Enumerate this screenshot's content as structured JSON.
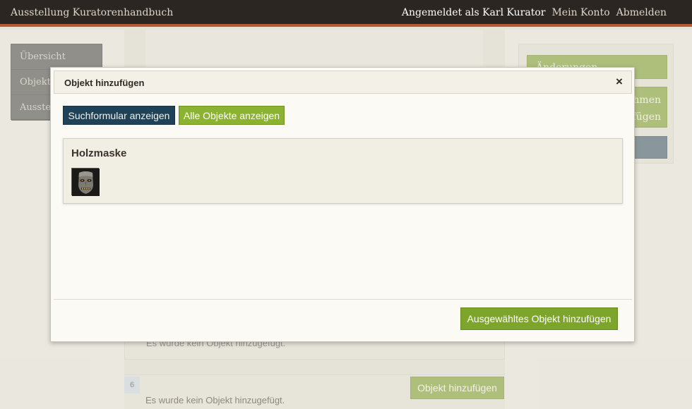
{
  "topbar": {
    "app_title": "Ausstellung Kuratorenhandbuch",
    "user_label": "Angemeldet als Karl Kurator",
    "account_link": "Mein Konto",
    "logout_link": "Abmelden"
  },
  "sidebar": {
    "items": [
      {
        "label": "Übersicht"
      },
      {
        "label": "Objekte"
      },
      {
        "label": "Ausstellungen"
      }
    ]
  },
  "right_panel": {
    "apply_changes_label": "Änderungen übernehmen",
    "add_label_line1": "ufnehmen",
    "add_label_line2": "hinzufügen"
  },
  "background_rows": {
    "faint_text": "Es wurde kein Objekt hinzugefügt.",
    "row_number": "6",
    "row_message": "Es wurde kein Objekt hinzugefügt.",
    "row_add_button": "Objekt hinzufügen"
  },
  "modal": {
    "title": "Objekt hinzufügen",
    "close_icon": "×",
    "search_button": "Suchformular anzeigen",
    "all_objects_button": "Alle Objekte anzeigen",
    "object": {
      "name": "Holzmaske",
      "thumbnail_icon": "wooden-mask-thumbnail"
    },
    "add_selected_button": "Ausgewähltes Objekt hinzufügen"
  },
  "colors": {
    "topbar_bg": "#2c2623",
    "accent_stripe": "#b45a34",
    "primary_green": "#8bb230",
    "dark_blue": "#1f4258"
  }
}
